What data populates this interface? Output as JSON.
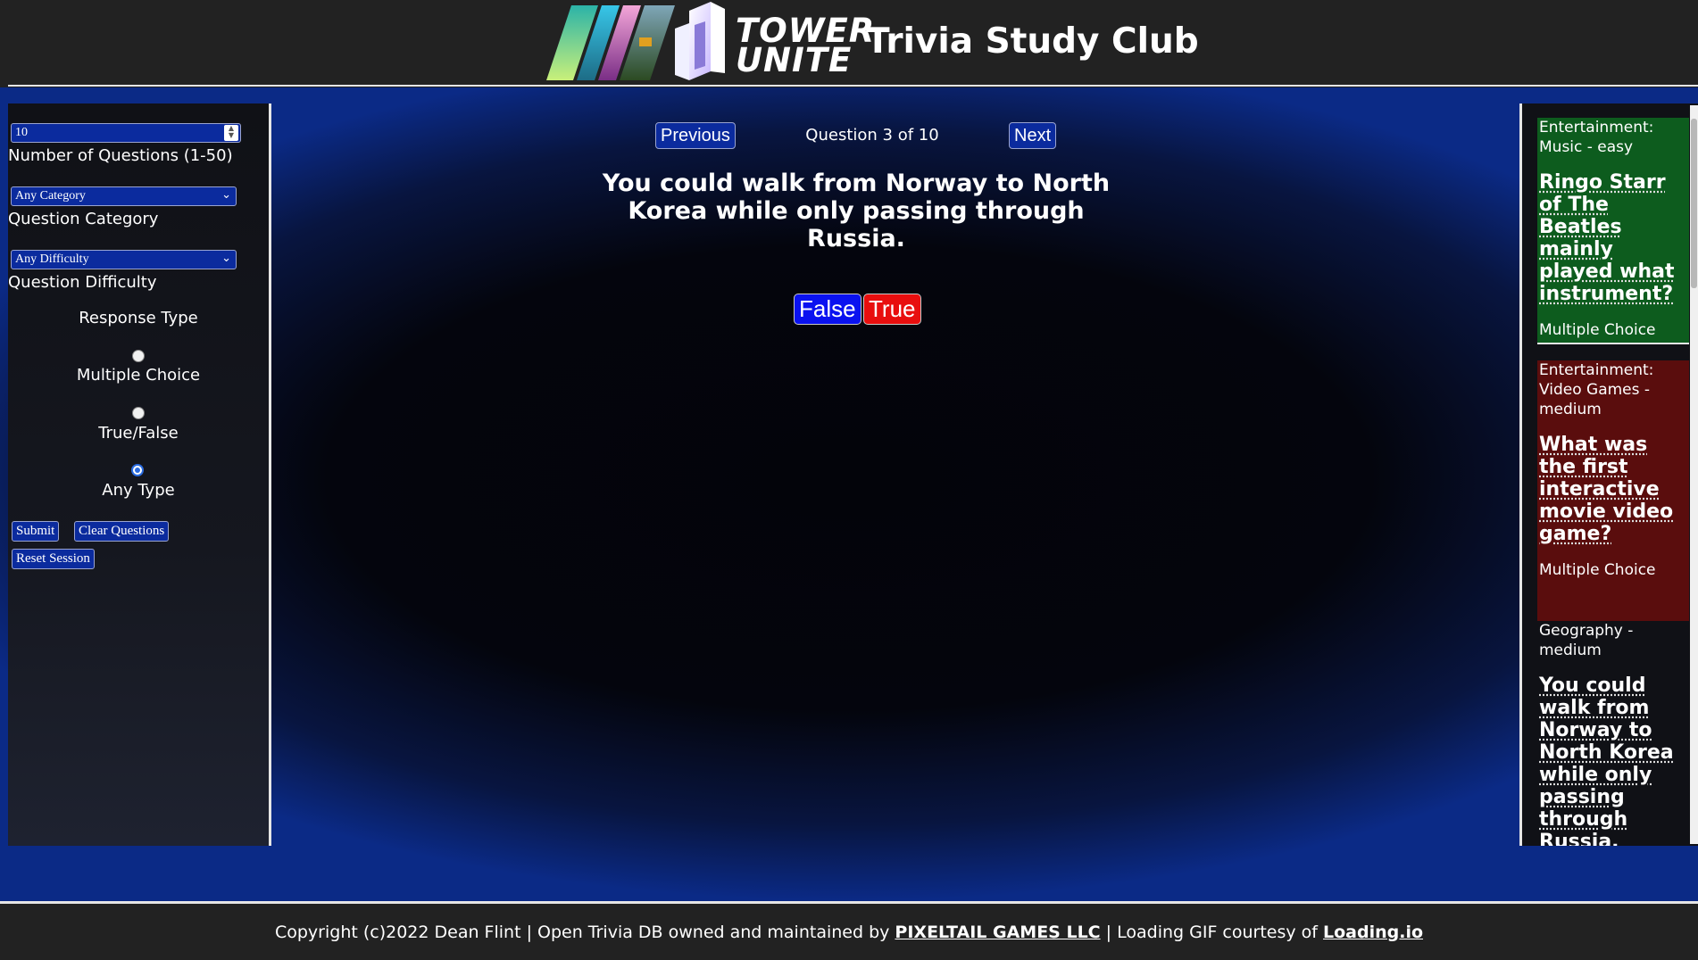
{
  "header": {
    "logo_word_line1": "TOWER",
    "logo_word_line2": "UNITE",
    "site_title": "Trivia Study Club"
  },
  "sidebar": {
    "num_questions_value": "10",
    "num_questions_label": "Number of Questions (1-50)",
    "category_selected": "Any Category",
    "category_label": "Question Category",
    "difficulty_selected": "Any Difficulty",
    "difficulty_label": "Question Difficulty",
    "response_type_label": "Response Type",
    "response_options": [
      {
        "label": "Multiple Choice",
        "selected": false
      },
      {
        "label": "True/False",
        "selected": false
      },
      {
        "label": "Any Type",
        "selected": true
      }
    ],
    "submit_label": "Submit",
    "clear_label": "Clear Questions",
    "reset_label": "Reset Session"
  },
  "main": {
    "previous_label": "Previous",
    "next_label": "Next",
    "counter": "Question 3 of 10",
    "question": "You could walk from Norway to North Korea while only passing through Russia.",
    "answers": [
      {
        "label": "False",
        "color": "#0a12f0"
      },
      {
        "label": "True",
        "color": "#e80e0e"
      }
    ]
  },
  "history": [
    {
      "meta": "Entertainment: Music - easy",
      "question": "Ringo Starr of The Beatles mainly played what instrument?",
      "type": "Multiple Choice",
      "bg": "#0d5c1e"
    },
    {
      "meta": "Entertainment: Video Games - medium",
      "question": "What was the first interactive movie video game?",
      "type": "Multiple Choice",
      "bg": "#5a0d0d"
    },
    {
      "meta": "Geography - medium",
      "question": "You could walk from Norway to North Korea while only passing through Russia.",
      "type": "",
      "bg": "#101116"
    }
  ],
  "footer": {
    "text_a": "Copyright (c)2022 Dean Flint | Open Trivia DB owned and maintained by ",
    "link_a": "PIXELTAIL GAMES LLC",
    "text_b": " | Loading GIF courtesy of ",
    "link_b": "Loading.io"
  }
}
